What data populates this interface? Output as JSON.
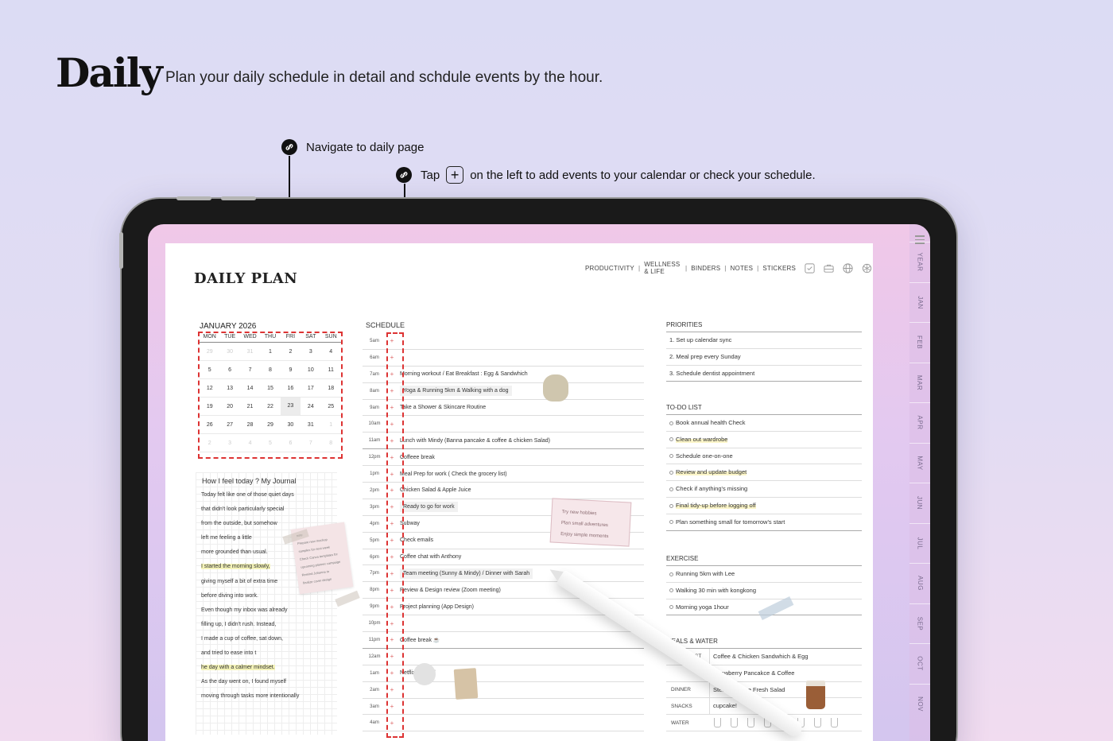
{
  "header": {
    "title": "Daily",
    "subtitle": "Plan your daily schedule in detail and schdule events by the hour."
  },
  "callouts": {
    "first": "Navigate to daily page",
    "second_before": "Tap",
    "second_plus": "+",
    "second_after": "on the left to add events to your calendar or check your schedule."
  },
  "planner": {
    "title": "DAILY PLAN",
    "nav": [
      "PRODUCTIVITY",
      "WELLNESS & LIFE",
      "BINDERS",
      "NOTES",
      "STICKERS"
    ],
    "nav_icons": [
      "checkbox-icon",
      "briefcase-icon",
      "globe-icon",
      "openai-icon"
    ],
    "tabs": [
      "YEAR",
      "JAN",
      "FEB",
      "MAR",
      "APR",
      "MAY",
      "JUN",
      "JUL",
      "AUG",
      "SEP",
      "OCT",
      "NOV"
    ]
  },
  "calendar": {
    "month": "JANUARY 2026",
    "weekdays": [
      "MON",
      "TUE",
      "WED",
      "THU",
      "FRI",
      "SAT",
      "SUN"
    ],
    "weeks": [
      [
        "29",
        "30",
        "31",
        "1",
        "2",
        "3",
        "4"
      ],
      [
        "5",
        "6",
        "7",
        "8",
        "9",
        "10",
        "11"
      ],
      [
        "12",
        "13",
        "14",
        "15",
        "16",
        "17",
        "18"
      ],
      [
        "19",
        "20",
        "21",
        "22",
        "23",
        "24",
        "25"
      ],
      [
        "26",
        "27",
        "28",
        "29",
        "30",
        "31",
        "1"
      ],
      [
        "2",
        "3",
        "4",
        "5",
        "6",
        "7",
        "8"
      ]
    ]
  },
  "journal": {
    "title": "How I feel today ? My Journal",
    "lines": [
      "Today felt like one of those quiet days",
      "that didn't look particularly special",
      "from the outside, but somehow",
      "left me feeling a little",
      "more grounded than usual.",
      "I started the morning slowly,",
      "giving myself a bit of extra time",
      "before diving into work.",
      "Even though my inbox was already",
      "filling up, I didn't rush. Instead,",
      "I made a cup of coffee, sat down,",
      "and tried to ease into t",
      "he day with a calmer mindset.",
      "As the day went on, I found myself",
      "moving through tasks more intentionally"
    ],
    "sticky_title": "note",
    "sticky_lines": [
      "Prepare new mockup",
      "samples for next week",
      "Check Canva templates for",
      "upcoming planner campaign",
      "Remind Johanna to",
      "finalize cover design"
    ]
  },
  "schedule": {
    "title": "SCHEDULE",
    "rows": [
      {
        "time": "5am",
        "text": ""
      },
      {
        "time": "6am",
        "text": ""
      },
      {
        "time": "7am",
        "text": "Morning workout / Eat Breakfast : Egg & Sandwhich"
      },
      {
        "time": "8am",
        "text": "Yoga & Running 5km & Walking with a dog"
      },
      {
        "time": "9am",
        "text": "Take a Shower & Skincare Routine"
      },
      {
        "time": "10am",
        "text": ""
      },
      {
        "time": "11am",
        "text": "Lunch with Mindy (Banna pancake & coffee & chicken Salad)"
      },
      {
        "time": "12pm",
        "text": "Coffeee break"
      },
      {
        "time": "1pm",
        "text": "Meal Prep for work ( Check the grocery list)"
      },
      {
        "time": "2pm",
        "text": "Chicken Salad & Apple Juice"
      },
      {
        "time": "3pm",
        "text": "Ready to go for work"
      },
      {
        "time": "4pm",
        "text": "Subway"
      },
      {
        "time": "5pm",
        "text": "Check emails"
      },
      {
        "time": "6pm",
        "text": "Coffee chat with Anthony"
      },
      {
        "time": "7pm",
        "text": "Team meeting (Sunny & Mindy) / Dinner with Sarah"
      },
      {
        "time": "8pm",
        "text": "Review & Design review (Zoom meeting)"
      },
      {
        "time": "9pm",
        "text": "Project planning (App Design)"
      },
      {
        "time": "10pm",
        "text": ""
      },
      {
        "time": "11pm",
        "text": "Coffee break ☕"
      },
      {
        "time": "12am",
        "text": ""
      },
      {
        "time": "1am",
        "text": "Netflix & Chillll"
      },
      {
        "time": "2am",
        "text": ""
      },
      {
        "time": "3am",
        "text": ""
      },
      {
        "time": "4am",
        "text": ""
      }
    ],
    "plus_symbol": "+",
    "sticker_lines": [
      "Try new hobbies",
      "Plan small adventures",
      "Enjoy simple moments"
    ]
  },
  "priorities": {
    "title": "PRIORITIES",
    "items": [
      "1. Set up calendar sync",
      "2. Meal prep every Sunday",
      "3. Schedule dentist appointment"
    ]
  },
  "todo": {
    "title": "TO-DO LIST",
    "items": [
      "Book annual health Check",
      "Clean out wardrobe",
      "Schedule one-on-one",
      "Review and update budget",
      "Check if anything's missing",
      "Final tidy-up before logging off",
      "Plan something small for tomorrow's start"
    ]
  },
  "exercise": {
    "title": "EXERCISE",
    "items": [
      "Running 5km with Lee",
      "Walking 30 min with kongkong",
      "Morning yoga 1hour"
    ]
  },
  "meals": {
    "title": "MEALS & WATER",
    "rows": [
      {
        "label": "BREAKFAST",
        "value": "Coffee & Chicken Sandwhich & Egg"
      },
      {
        "label": "",
        "value": "Strawberry Pancakce & Coffee"
      },
      {
        "label": "DINNER",
        "value": "Steak & Some Fresh Salad"
      },
      {
        "label": "SNACKS",
        "value": "cupcake!"
      }
    ],
    "water_label": "WATER",
    "cups": 8
  },
  "colors": {
    "accent_dash": "#dd3333",
    "bg_top": "#dcdcf4",
    "bg_bottom": "#f1dcf0"
  }
}
